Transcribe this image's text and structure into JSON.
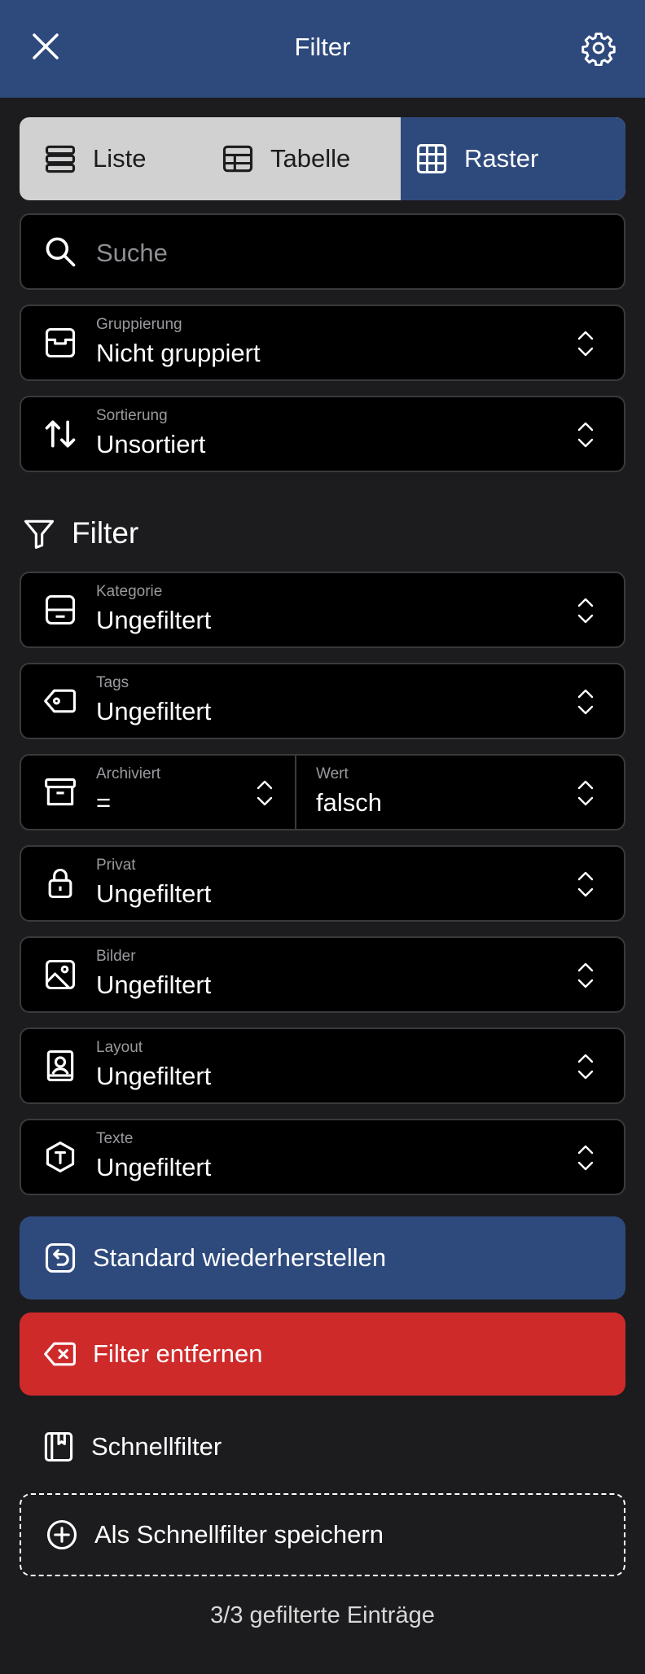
{
  "header": {
    "title": "Filter",
    "close_icon": "close-icon",
    "settings_icon": "gear-icon"
  },
  "view_modes": {
    "selected": "Raster",
    "items": [
      {
        "label": "Liste",
        "icon": "list-icon"
      },
      {
        "label": "Tabelle",
        "icon": "table-icon"
      },
      {
        "label": "Raster",
        "icon": "grid-icon"
      }
    ]
  },
  "search": {
    "placeholder": "Suche",
    "value": ""
  },
  "grouping": {
    "label": "Gruppierung",
    "value": "Nicht gruppiert"
  },
  "sorting": {
    "label": "Sortierung",
    "value": "Unsortiert"
  },
  "filter_section": {
    "title": "Filter"
  },
  "filters": {
    "category": {
      "label": "Kategorie",
      "value": "Ungefiltert"
    },
    "tags": {
      "label": "Tags",
      "value": "Ungefiltert"
    },
    "archived": {
      "label": "Archiviert",
      "operator": "=",
      "value_label": "Wert",
      "value": "falsch"
    },
    "private": {
      "label": "Privat",
      "value": "Ungefiltert"
    },
    "images": {
      "label": "Bilder",
      "value": "Ungefiltert"
    },
    "layout": {
      "label": "Layout",
      "value": "Ungefiltert"
    },
    "texts": {
      "label": "Texte",
      "value": "Ungefiltert"
    }
  },
  "actions": {
    "reset_label": "Standard wiederherstellen",
    "remove_label": "Filter entfernen"
  },
  "quick_filters": {
    "title": "Schnellfilter",
    "save_label": "Als Schnellfilter speichern"
  },
  "footer": {
    "count_text": "3/3 gefilterte Einträge"
  },
  "colors": {
    "header": "#2e4a7d",
    "background": "#1c1c1e",
    "field": "#000000",
    "danger": "#cf2a2a",
    "segment_bg": "#d1d1d1"
  }
}
